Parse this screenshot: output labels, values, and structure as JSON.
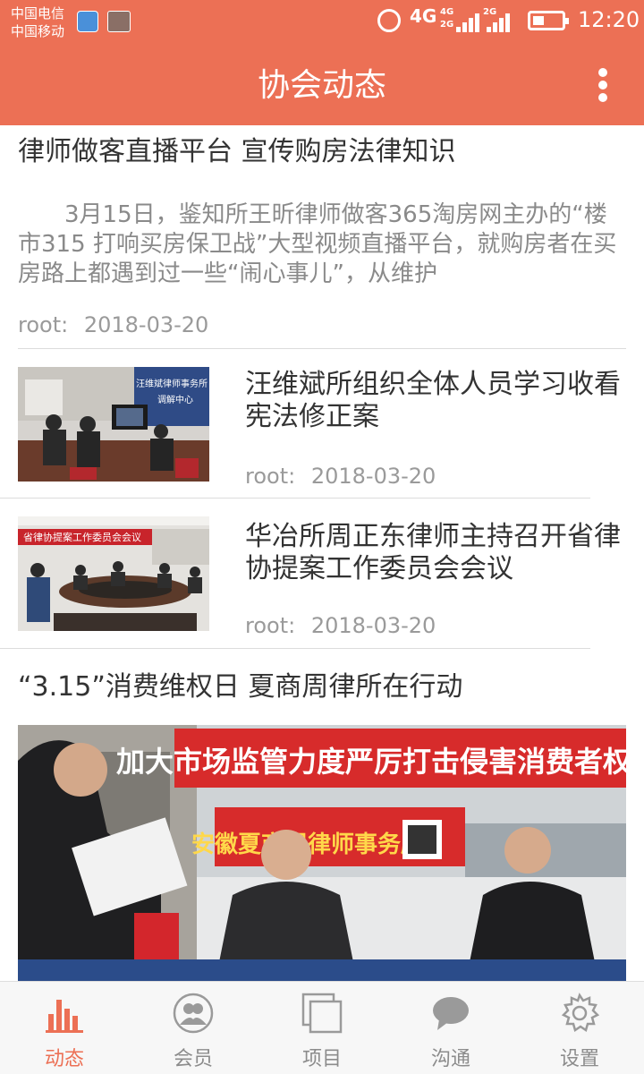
{
  "status_bar": {
    "carrier_1": "中国电信",
    "carrier_2": "中国移动",
    "network": "4G",
    "signal_1": "4G",
    "signal_2": "2G",
    "signal_3": "2G",
    "time": "12:20"
  },
  "header": {
    "title": "协会动态",
    "menu_icon": "more-vertical-icon",
    "color": "#ec7055"
  },
  "articles": [
    {
      "title": "律师做客直播平台 宣传购房法律知识",
      "summary": "3月15日，鉴知所王昕律师做客365淘房网主办的“楼市315 打响买房保卫战”大型视频直播平台，就购房者在买房路上都遇到过一些“闹心事儿”，从维护",
      "author": "root:",
      "date": "2018-03-20"
    },
    {
      "title": "汪维斌所组织全体人员学习收看宪法修正案",
      "thumb_sign": "汪维斌律师事务所",
      "thumb_sign_2": "调解中心",
      "author": "root:",
      "date": "2018-03-20"
    },
    {
      "title": "华冶所周正东律师主持召开省律协提案工作委员会会议",
      "thumb_banner": "省律协提案工作委员会会议",
      "author": "root:",
      "date": "2018-03-20"
    },
    {
      "title": "“3.15”消费维权日 夏商周律所在行动",
      "photo_banner": "加大市场监管力度严厉打击侵害消费者权益行",
      "photo_sign": "安徽夏商周律师事务所"
    }
  ],
  "tabs": [
    {
      "label": "动态",
      "icon": "bar-chart-icon",
      "active": true
    },
    {
      "label": "会员",
      "icon": "members-icon",
      "active": false
    },
    {
      "label": "项目",
      "icon": "projects-icon",
      "active": false
    },
    {
      "label": "沟通",
      "icon": "chat-icon",
      "active": false
    },
    {
      "label": "设置",
      "icon": "settings-icon",
      "active": false
    }
  ],
  "colors": {
    "accent": "#ec7055",
    "inactive": "#8c8c8c"
  }
}
